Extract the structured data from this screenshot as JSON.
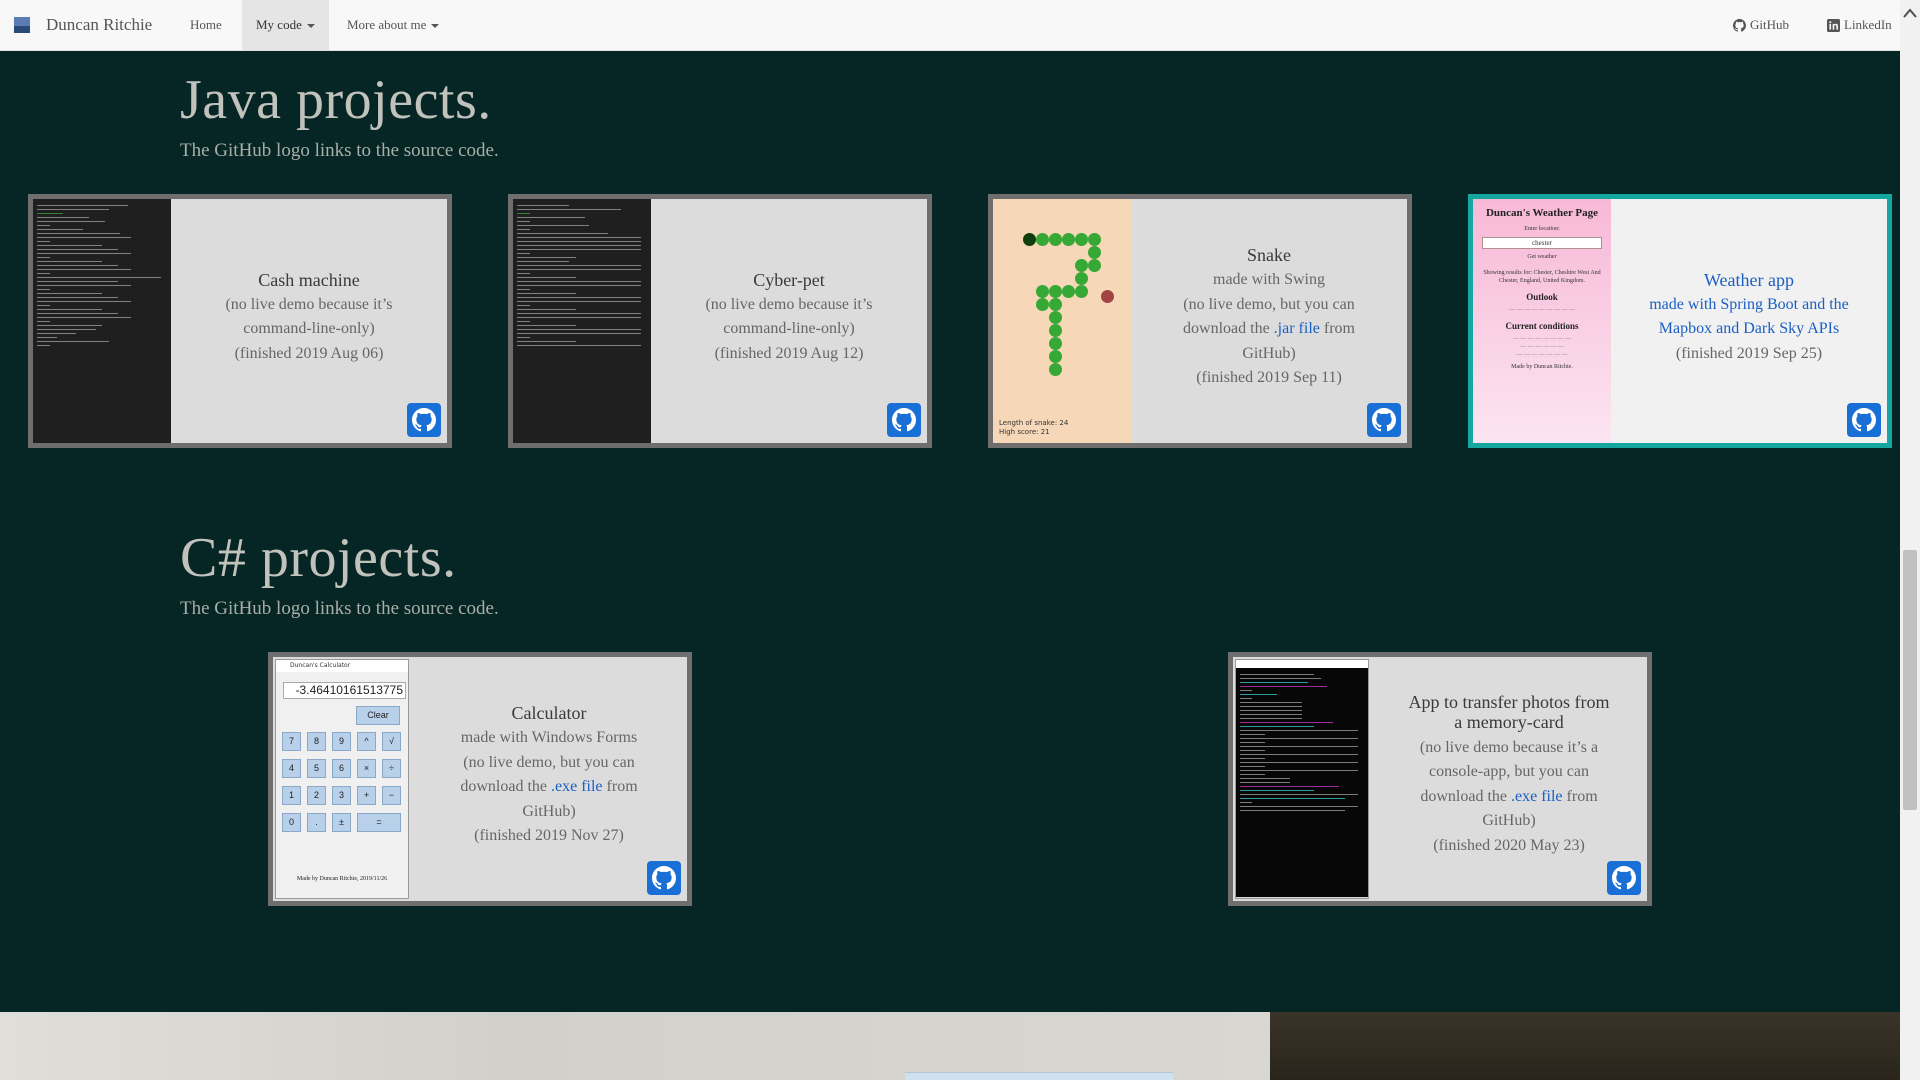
{
  "nav": {
    "brand": "Duncan Ritchie",
    "home": "Home",
    "my_code": "My code",
    "more_about": "More about me",
    "github": "GitHub",
    "linkedin": "LinkedIn"
  },
  "java": {
    "title": "Java projects.",
    "subtitle": "The GitHub logo links to the source code.",
    "cards": [
      {
        "title": "Cash machine",
        "lines": [
          "(no live demo because it’s",
          "command-line-only)",
          "(finished 2019 Aug 06)"
        ]
      },
      {
        "title": "Cyber-pet",
        "lines": [
          "(no live demo because it’s",
          "command-line-only)",
          "(finished 2019 Aug 12)"
        ]
      },
      {
        "title": "Snake",
        "line1": "made with Swing",
        "line2": "(no live demo, but you can",
        "line3_pre": "download the ",
        "line3_link": ".jar file",
        "line3_post": " from",
        "line4": "GitHub)",
        "line5": "(finished 2019 Sep 11)",
        "game_length": "Length of snake: 24",
        "game_high": "High score: 21"
      },
      {
        "title": "Weather app",
        "line1": "made with Spring Boot and the",
        "line2": "Mapbox and Dark Sky APIs",
        "line3": "(finished 2019 Sep 25)",
        "thumb": {
          "page_title": "Duncan's Weather Page",
          "enter": "Enter location:",
          "input": "chester",
          "get": "Get weather",
          "results": "Showing results for: Chester, Cheshire West And Chester, England, United Kingdom.",
          "outlook": "Outlook",
          "current": "Current conditions",
          "footer_made": "Made by Duncan Ritchie."
        }
      }
    ]
  },
  "csharp": {
    "title": "C# projects.",
    "subtitle": "The GitHub logo links to the source code.",
    "cards": [
      {
        "title": "Calculator",
        "line1": "made with Windows Forms",
        "line2": "(no live demo, but you can",
        "line3_pre": "download the ",
        "line3_link": ".exe file",
        "line3_post": " from",
        "line4": "GitHub)",
        "line5": "(finished 2019 Nov 27)",
        "calc": {
          "window_title": "Duncan's Calculator",
          "display": "-3.46410161513775",
          "clear": "Clear",
          "keys": [
            "7",
            "8",
            "9",
            "^",
            "√",
            "4",
            "5",
            "6",
            "×",
            "÷",
            "1",
            "2",
            "3",
            "+",
            "−",
            "0",
            ".",
            "±",
            "="
          ],
          "footer": "Made by Duncan Ritchie, 2019/11/26"
        }
      },
      {
        "title_l1": "App to transfer photos from",
        "title_l2": "a memory-card",
        "line1": "(no live demo because it’s a",
        "line2": "console-app, but you can",
        "line3_pre": "download the ",
        "line3_link": ".exe file",
        "line3_post": " from",
        "line4": "GitHub)",
        "line5": "(finished 2020 May 23)"
      }
    ]
  },
  "colors": {
    "background": "#062525",
    "accent": "#1a6fd6",
    "highlight_border": "#14a7a0"
  }
}
